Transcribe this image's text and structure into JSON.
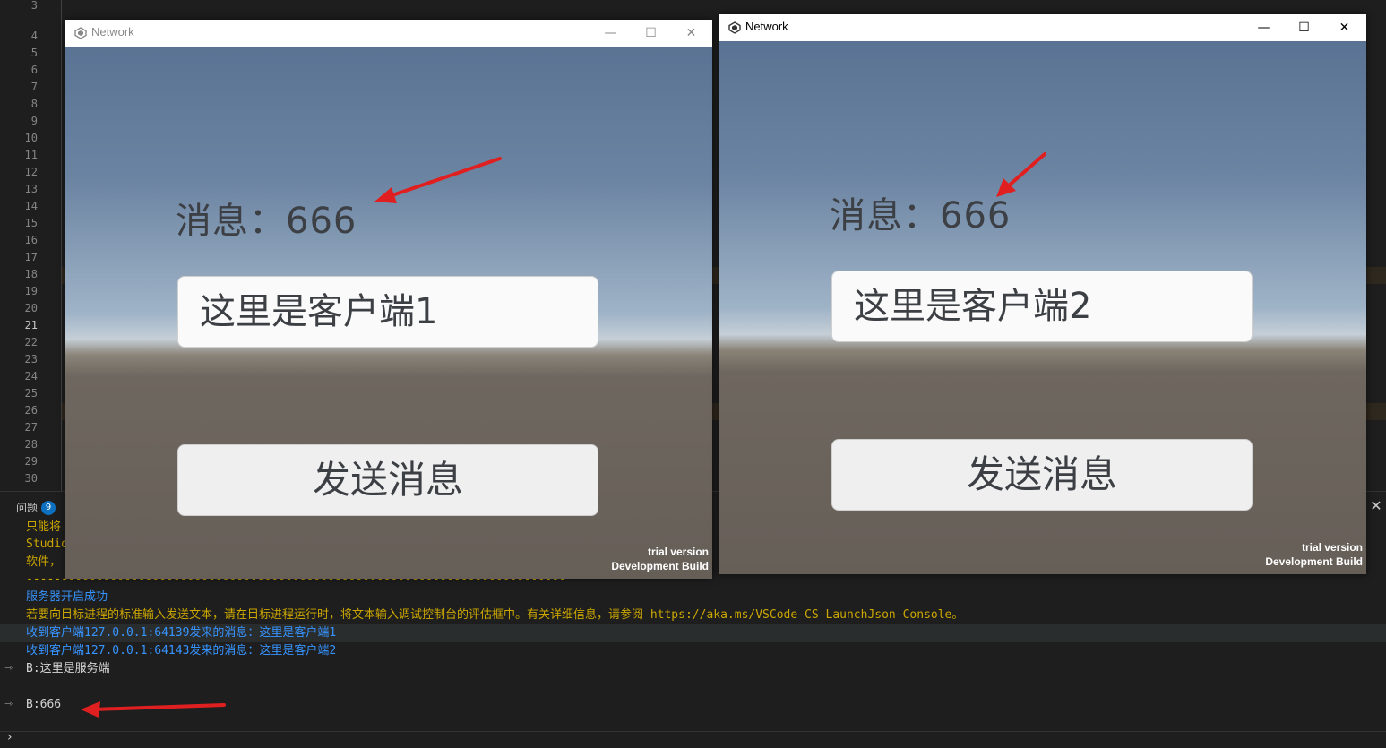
{
  "editor": {
    "line_numbers": [
      "3",
      "4",
      "5",
      "6",
      "7",
      "8",
      "9",
      "10",
      "11",
      "12",
      "13",
      "14",
      "15",
      "16",
      "17",
      "18",
      "19",
      "20",
      "21",
      "22",
      "23",
      "24",
      "25",
      "26",
      "27",
      "28",
      "29",
      "30"
    ],
    "current_line": "21"
  },
  "panel": {
    "tab_label": "问题",
    "problems_count": "9",
    "close_icon": "✕",
    "output": {
      "truncated_1": "只能将",
      "truncated_2": "Studio",
      "truncated_3": "软件，",
      "separator": "-------------------------------------------------------------------------------------------------------",
      "server_started": "服务器开启成功",
      "hint": "若要向目标进程的标准输入发送文本，请在目标进程运行时，将文本输入调试控制台的评估框中。有关详细信息，请参阅 https://aka.ms/VSCode-CS-LaunchJson-Console。",
      "recv_1": "收到客户端127.0.0.1:64139发来的消息：这里是客户端1",
      "recv_2": "收到客户端127.0.0.1:64143发来的消息：这里是客户端2",
      "echo_1": "B:这里是服务端",
      "echo_2": "B:666"
    }
  },
  "windows": [
    {
      "title": "Network",
      "message_label": "消息：666",
      "input_value": "这里是客户端1",
      "send_button": "发送消息",
      "watermark_line1": "trial version",
      "watermark_line2": "Development Build"
    },
    {
      "title": "Network",
      "message_label": "消息：666",
      "input_value": "这里是客户端2",
      "send_button": "发送消息",
      "watermark_line1": "trial version",
      "watermark_line2": "Development Build"
    }
  ],
  "window_controls": {
    "minimize": "—",
    "maximize": "☐",
    "close": "✕"
  },
  "colors": {
    "annotation_arrow": "#e02020",
    "console_blue": "#3794ff",
    "console_yellow": "#cca700"
  }
}
